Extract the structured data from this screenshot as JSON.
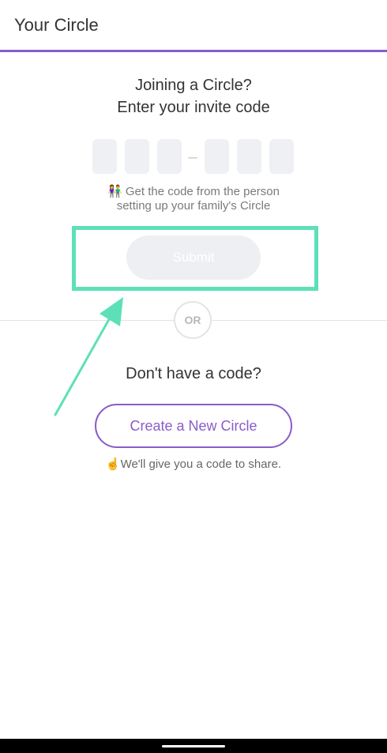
{
  "header": {
    "title": "Your Circle"
  },
  "join": {
    "title_line1": "Joining a Circle?",
    "title_line2": "Enter your invite code",
    "code_separator": "–",
    "hint_line1": "👫 Get the code from the person",
    "hint_line2": "setting up your family's Circle",
    "submit_label": "Submit"
  },
  "divider": {
    "or_label": "OR"
  },
  "create": {
    "title": "Don't have a code?",
    "button_label": "Create a New Circle",
    "note": "☝️We'll give you a code to share."
  },
  "colors": {
    "accent": "#8a5cc9",
    "highlight": "#5de0b8"
  }
}
